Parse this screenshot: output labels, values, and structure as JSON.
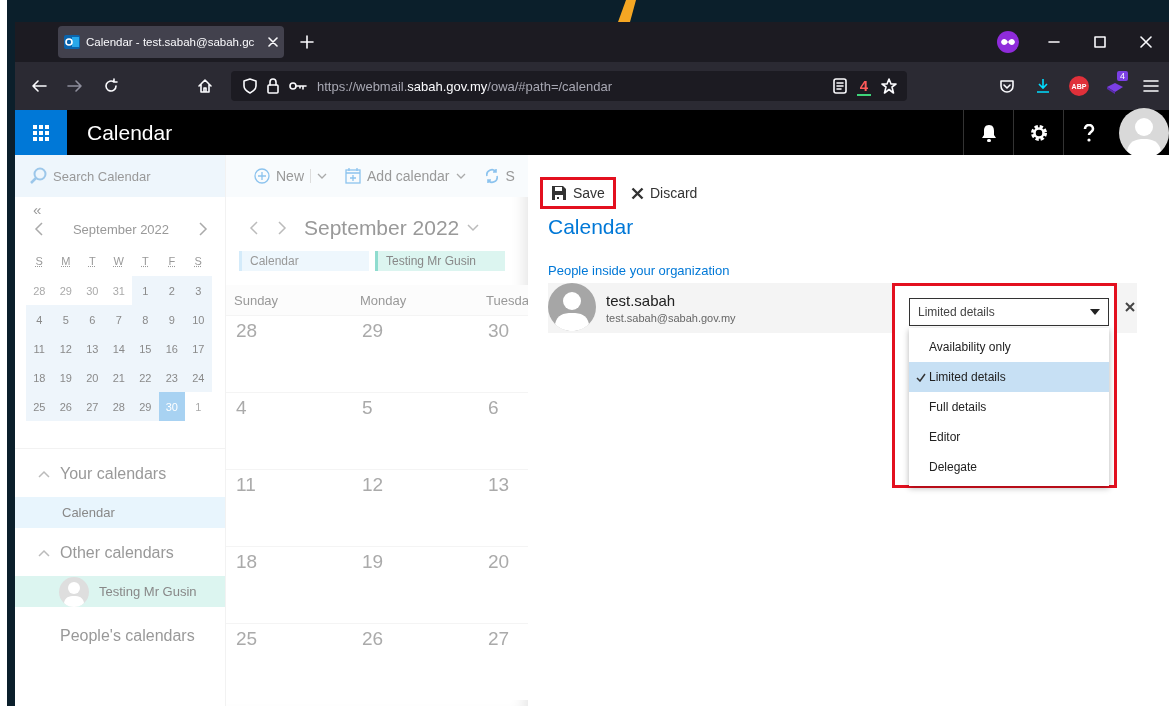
{
  "browser": {
    "tab": {
      "title": "Calendar - test.sabah@sabah.gc",
      "selected": true
    },
    "url": [
      {
        "text": "https://webmail.",
        "emphasis": false
      },
      {
        "text": "sabah.gov.my",
        "emphasis": true
      },
      {
        "text": "/owa/#path=/calendar",
        "emphasis": false
      }
    ],
    "counter_label": "4",
    "abp_label": "ABP",
    "extension_badge": "4"
  },
  "app": {
    "title": "Calendar"
  },
  "sidebar": {
    "search": {
      "placeholder": "Search Calendar"
    },
    "collapse": "«",
    "mini_calendar": {
      "month": "September 2022",
      "weekdays": [
        "S",
        "M",
        "T",
        "W",
        "T",
        "F",
        "S"
      ],
      "weeks": [
        [
          {
            "day": "28",
            "other_month": true,
            "selected": false
          },
          {
            "day": "29",
            "other_month": true,
            "selected": false
          },
          {
            "day": "30",
            "other_month": true,
            "selected": false
          },
          {
            "day": "31",
            "other_month": true,
            "selected": false
          },
          {
            "day": "1",
            "other_month": false,
            "selected": false
          },
          {
            "day": "2",
            "other_month": false,
            "selected": false
          },
          {
            "day": "3",
            "other_month": false,
            "selected": false
          }
        ],
        [
          {
            "day": "4",
            "other_month": false,
            "selected": false
          },
          {
            "day": "5",
            "other_month": false,
            "selected": false
          },
          {
            "day": "6",
            "other_month": false,
            "selected": false
          },
          {
            "day": "7",
            "other_month": false,
            "selected": false
          },
          {
            "day": "8",
            "other_month": false,
            "selected": false
          },
          {
            "day": "9",
            "other_month": false,
            "selected": false
          },
          {
            "day": "10",
            "other_month": false,
            "selected": false
          }
        ],
        [
          {
            "day": "11",
            "other_month": false,
            "selected": false
          },
          {
            "day": "12",
            "other_month": false,
            "selected": false
          },
          {
            "day": "13",
            "other_month": false,
            "selected": false
          },
          {
            "day": "14",
            "other_month": false,
            "selected": false
          },
          {
            "day": "15",
            "other_month": false,
            "selected": false
          },
          {
            "day": "16",
            "other_month": false,
            "selected": false
          },
          {
            "day": "17",
            "other_month": false,
            "selected": false
          }
        ],
        [
          {
            "day": "18",
            "other_month": false,
            "selected": false
          },
          {
            "day": "19",
            "other_month": false,
            "selected": false
          },
          {
            "day": "20",
            "other_month": false,
            "selected": false
          },
          {
            "day": "21",
            "other_month": false,
            "selected": false
          },
          {
            "day": "22",
            "other_month": false,
            "selected": false
          },
          {
            "day": "23",
            "other_month": false,
            "selected": false
          },
          {
            "day": "24",
            "other_month": false,
            "selected": false
          }
        ],
        [
          {
            "day": "25",
            "other_month": false,
            "selected": false
          },
          {
            "day": "26",
            "other_month": false,
            "selected": false
          },
          {
            "day": "27",
            "other_month": false,
            "selected": false
          },
          {
            "day": "28",
            "other_month": false,
            "selected": false
          },
          {
            "day": "29",
            "other_month": false,
            "selected": false
          },
          {
            "day": "30",
            "other_month": false,
            "selected": true
          },
          {
            "day": "1",
            "other_month": true,
            "selected": false
          }
        ]
      ]
    },
    "nav": [
      {
        "kind": "group",
        "label": "Your calendars",
        "expanded": true,
        "children": [
          {
            "kind": "plain",
            "label": "Calendar",
            "selected": true,
            "color": "#e8f5fd"
          }
        ]
      },
      {
        "kind": "group",
        "label": "Other calendars",
        "expanded": true,
        "children": [
          {
            "kind": "person",
            "label": "Testing Mr Gusin",
            "selected": false,
            "color": "#dcf5f0"
          }
        ]
      },
      {
        "kind": "link",
        "label": "People's calendars"
      }
    ]
  },
  "toolbar": [
    {
      "kind": "new",
      "label": "New",
      "menu": true
    },
    {
      "kind": "add",
      "label": "Add calendar",
      "menu": true
    },
    {
      "kind": "sync",
      "label": "S",
      "menu": false
    }
  ],
  "month_view": {
    "title": "September 2022",
    "legend": [
      {
        "label": "Calendar",
        "color": "#d4ebfa"
      },
      {
        "label": "Testing Mr Gusin",
        "color": "#8fdccf"
      }
    ],
    "day_headers": [
      "Sunday",
      "Monday",
      "Tuesda"
    ],
    "weeks": [
      [
        "28",
        "29",
        "30"
      ],
      [
        "4",
        "5",
        "6"
      ],
      [
        "11",
        "12",
        "13"
      ],
      [
        "18",
        "19",
        "20"
      ],
      [
        "25",
        "26",
        "27"
      ]
    ]
  },
  "panel": {
    "actions": [
      {
        "kind": "save",
        "label": "Save",
        "highlighted": true
      },
      {
        "kind": "discard",
        "label": "Discard",
        "highlighted": false
      }
    ],
    "title": "Calendar",
    "section": "People inside your organization",
    "people": [
      {
        "name": "test.sabah",
        "email": "test.sabah@sabah.gov.my",
        "permission": "Limited details",
        "highlighted": true,
        "expanded": true,
        "options": [
          {
            "label": "Availability only",
            "selected": false
          },
          {
            "label": "Limited details",
            "selected": true
          },
          {
            "label": "Full details",
            "selected": false
          },
          {
            "label": "Editor",
            "selected": false
          },
          {
            "label": "Delegate",
            "selected": false
          }
        ]
      }
    ]
  }
}
